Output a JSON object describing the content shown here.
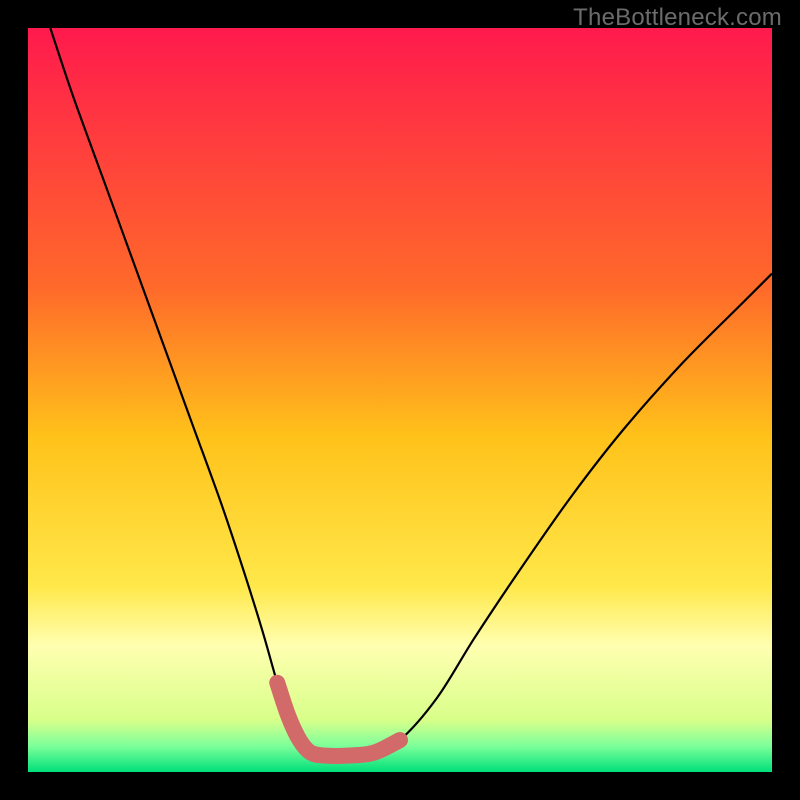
{
  "watermark": "TheBottleneck.com",
  "chart_data": {
    "type": "line",
    "title": "",
    "xlabel": "",
    "ylabel": "",
    "xlim": [
      0,
      100
    ],
    "ylim": [
      0,
      100
    ],
    "background_gradient": {
      "stops": [
        {
          "offset": 0.0,
          "color": "#ff1a4d"
        },
        {
          "offset": 0.35,
          "color": "#ff6a2a"
        },
        {
          "offset": 0.55,
          "color": "#ffc21a"
        },
        {
          "offset": 0.75,
          "color": "#ffe84a"
        },
        {
          "offset": 0.83,
          "color": "#ffffb0"
        },
        {
          "offset": 0.93,
          "color": "#d8ff8a"
        },
        {
          "offset": 0.965,
          "color": "#7dff9a"
        },
        {
          "offset": 1.0,
          "color": "#00e07a"
        }
      ]
    },
    "series": [
      {
        "name": "bottleneck-curve",
        "stroke": "#000000",
        "stroke_width": 2.2,
        "x": [
          3,
          6,
          10,
          14,
          18,
          22,
          26,
          29,
          31.5,
          33.5,
          35,
          36.5,
          38,
          40,
          43,
          46.5,
          50,
          55,
          60,
          66,
          73,
          80,
          88,
          96,
          100
        ],
        "y": [
          100,
          91,
          80,
          69,
          58,
          47,
          36,
          27,
          19,
          12,
          7.5,
          4.3,
          2.6,
          2.2,
          2.2,
          2.6,
          4.3,
          10,
          18,
          27,
          37,
          46,
          55,
          63,
          67
        ]
      },
      {
        "name": "optimal-band",
        "stroke": "#d36a6a",
        "stroke_width": 16,
        "linecap": "round",
        "x": [
          33.5,
          35,
          36.5,
          38,
          40,
          43,
          46.5,
          50
        ],
        "y": [
          12,
          7.5,
          4.3,
          2.6,
          2.2,
          2.2,
          2.6,
          4.3
        ]
      }
    ]
  }
}
